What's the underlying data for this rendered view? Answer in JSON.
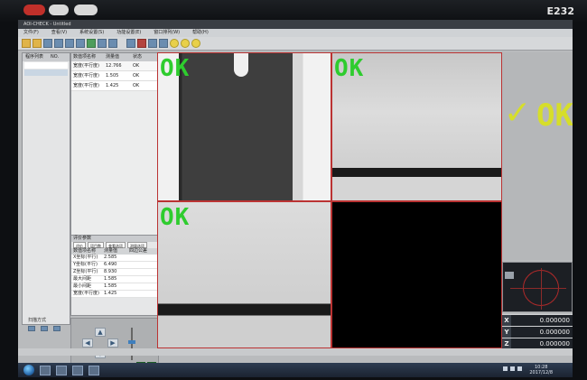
{
  "bezel": {
    "model_label": "E232"
  },
  "app": {
    "title": "AOI-CHECK - Untitled",
    "menus": [
      "文件(F)",
      "查看(V)",
      "系统设置(S)",
      "功能设置(E)",
      "窗口排列(W)",
      "帮助(H)"
    ]
  },
  "program_panel": {
    "header_name": "程序列表",
    "header_no": "NO.",
    "bottom_label": "扫描方式"
  },
  "measure_table": {
    "headers": [
      "数值项名称",
      "测量值",
      "状态"
    ],
    "rows": [
      [
        "宽度(平行度)",
        "12.766",
        "OK"
      ],
      [
        "宽度(平行度)",
        "1.505",
        "OK"
      ],
      [
        "宽度(平行度)",
        "1.425",
        "OK"
      ]
    ]
  },
  "eval_panel": {
    "title": "评价参数",
    "tabs": [
      "评价",
      "项目数",
      "查看选项",
      "测量选项"
    ],
    "headers": [
      "数值项名称",
      "测量值",
      "四边公差"
    ],
    "rows": [
      [
        "X坐标(平行)",
        "2.585",
        ""
      ],
      [
        "Y坐标(平行)",
        "6.490",
        ""
      ],
      [
        "Z坐标(平行)",
        "8.930",
        ""
      ],
      [
        "最大间距",
        "1.585",
        ""
      ],
      [
        "最小间距",
        "1.585",
        ""
      ],
      [
        "宽度(平行度)",
        "1.425",
        ""
      ]
    ]
  },
  "viewer": {
    "quadrants": [
      {
        "label": "OK"
      },
      {
        "label": "OK"
      },
      {
        "label": "OK"
      },
      {
        "label": ""
      }
    ]
  },
  "result": {
    "status_text": "OK",
    "check_icon": "✓",
    "color": "#d6de2a"
  },
  "coordinates": [
    {
      "axis": "X",
      "value": "0.000000"
    },
    {
      "axis": "Y",
      "value": "0.000000"
    },
    {
      "axis": "Z",
      "value": "0.000000"
    }
  ],
  "taskbar": {
    "clock_time": "10:28",
    "clock_date": "2017/12/8"
  },
  "colors": {
    "ok_green": "#2ecc2e",
    "frame_red": "#b33333"
  }
}
